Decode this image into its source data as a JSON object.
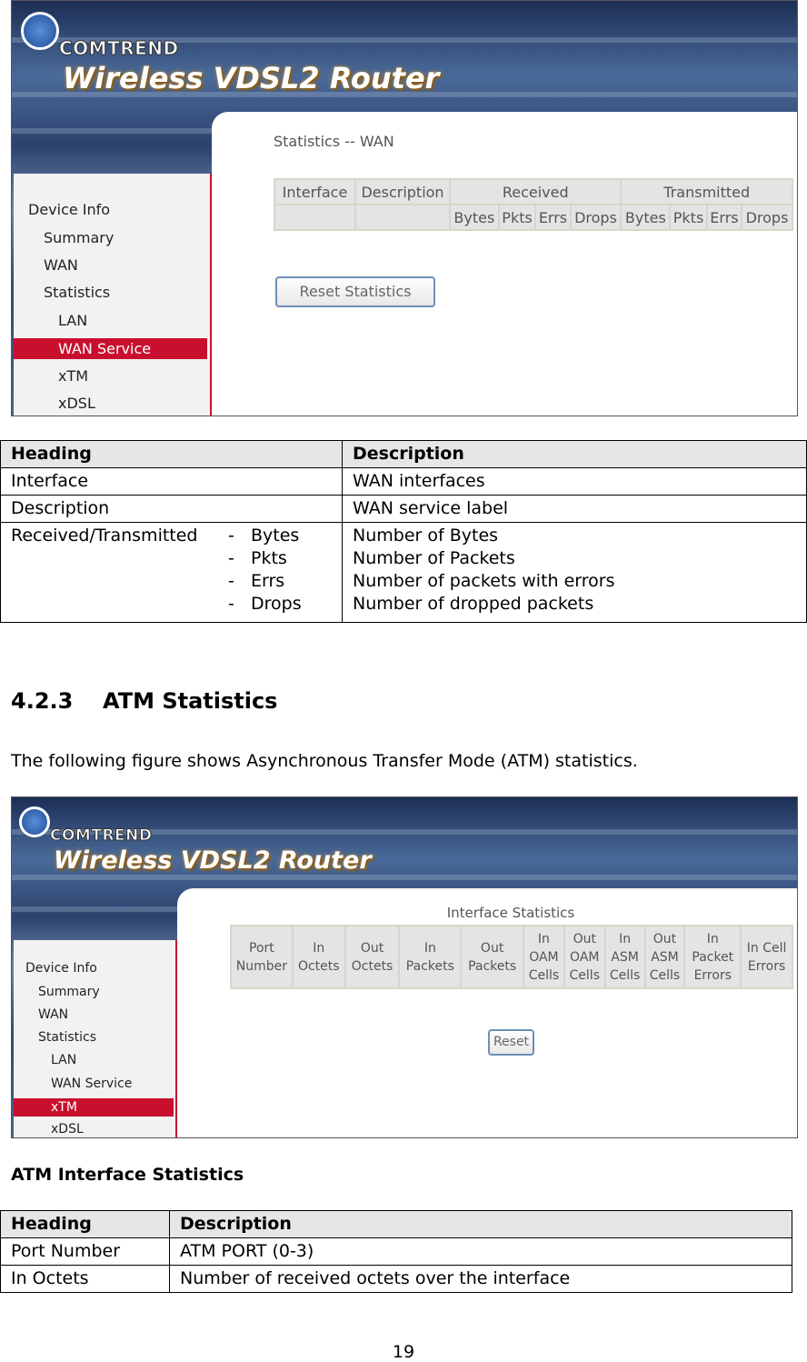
{
  "shot1": {
    "brand": "COMTREND",
    "product": "Wireless VDSL2 Router",
    "title": "Statistics -- WAN",
    "nav": [
      "Device Info",
      "Summary",
      "WAN",
      "Statistics",
      "LAN",
      "WAN Service",
      "xTM",
      "xDSL"
    ],
    "selected": "WAN Service",
    "headers": {
      "interface": "Interface",
      "description": "Description",
      "received": "Received",
      "transmitted": "Transmitted",
      "sub": [
        "Bytes",
        "Pkts",
        "Errs",
        "Drops"
      ]
    },
    "reset": "Reset Statistics"
  },
  "table1": {
    "headers": [
      "Heading",
      "Description"
    ],
    "rows": [
      [
        "Interface",
        "WAN interfaces"
      ],
      [
        "Description",
        "WAN service label"
      ]
    ],
    "rt": {
      "label": "Received/Transmitted",
      "dash": "-",
      "items": [
        "Bytes",
        "Pkts",
        "Errs",
        "Drops"
      ],
      "desc": [
        "Number of Bytes",
        "Number of Packets",
        "Number of packets with errors",
        "Number of dropped packets"
      ]
    }
  },
  "section": {
    "number": "4.2.3",
    "title": "ATM Statistics",
    "text": "The following figure shows Asynchronous Transfer Mode (ATM) statistics."
  },
  "shot2": {
    "brand": "COMTREND",
    "product": "Wireless VDSL2 Router",
    "title": "Interface Statistics",
    "nav": [
      "Device Info",
      "Summary",
      "WAN",
      "Statistics",
      "LAN",
      "WAN Service",
      "xTM",
      "xDSL"
    ],
    "selected": "xTM",
    "columns": [
      "Port Number",
      "In Octets",
      "Out Octets",
      "In Packets",
      "Out Packets",
      "In OAM Cells",
      "Out OAM Cells",
      "In ASM Cells",
      "Out ASM Cells",
      "In Packet Errors",
      "In Cell Errors"
    ],
    "reset": "Reset"
  },
  "subheading": "ATM Interface Statistics",
  "table2": {
    "headers": [
      "Heading",
      "Description"
    ],
    "rows": [
      [
        "Port Number",
        "ATM PORT (0-3)"
      ],
      [
        "In Octets",
        "Number of received octets over the interface"
      ]
    ]
  },
  "page_number": "19",
  "colors": {
    "accent": "#c8102e",
    "banner": "#2c426d"
  }
}
